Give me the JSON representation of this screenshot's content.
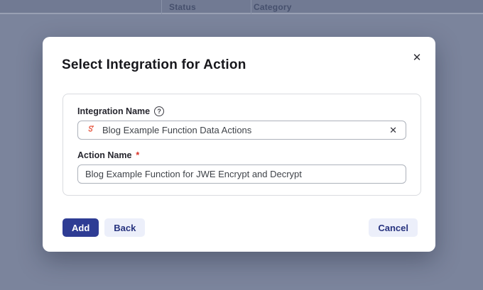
{
  "background": {
    "table_headers": [
      "Status",
      "Category"
    ]
  },
  "modal": {
    "title": "Select Integration for Action",
    "close_glyph": "✕",
    "fields": {
      "integration": {
        "label": "Integration Name",
        "help_glyph": "?",
        "value": "Blog Example Function Data Actions",
        "clear_glyph": "✕"
      },
      "action": {
        "label": "Action Name",
        "required_marker": "*",
        "value": "Blog Example Function for JWE Encrypt and Decrypt"
      }
    },
    "buttons": {
      "add": "Add",
      "back": "Back",
      "cancel": "Cancel"
    }
  },
  "colors": {
    "overlay": "#7b849c",
    "header_band": "#717a93",
    "primary_button": "#2e3c94",
    "secondary_button_bg": "#eceffa",
    "secondary_button_text": "#27337f",
    "integration_icon": "#e8644f",
    "required_marker": "#d93025"
  }
}
